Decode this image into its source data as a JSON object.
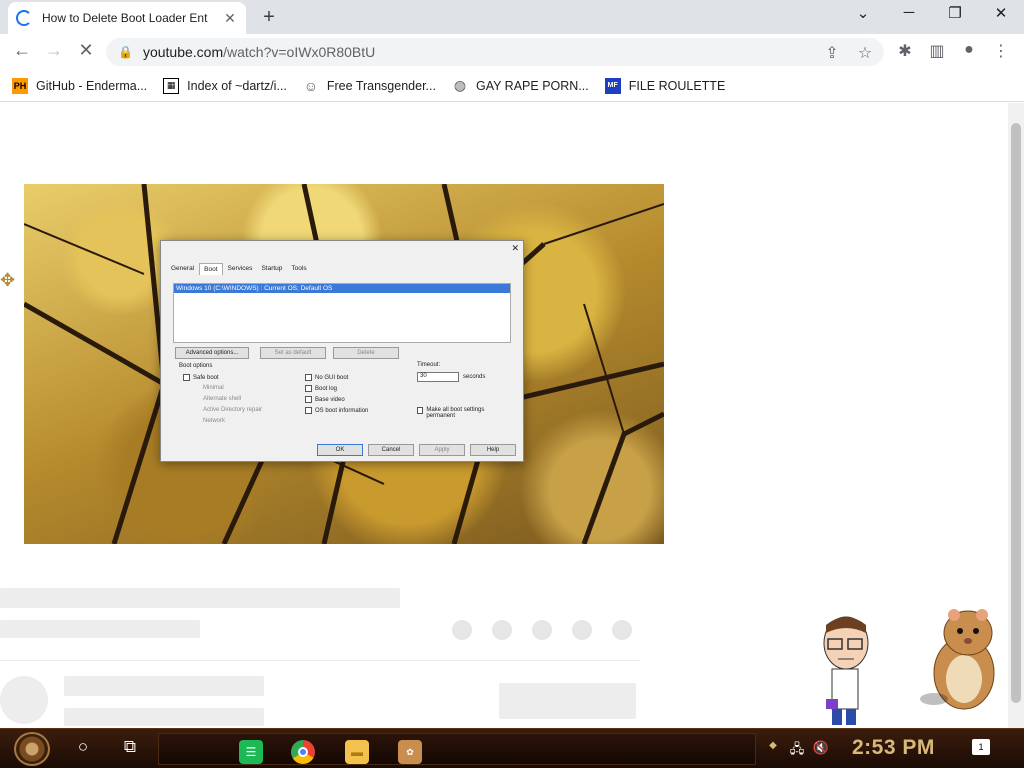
{
  "browser": {
    "tab": {
      "title": "How to Delete Boot Loader Ent",
      "close": "✕"
    },
    "new_tab": "+",
    "window_controls": {
      "chevron": "⌄",
      "minimize": "─",
      "restore": "❐",
      "close": "✕"
    },
    "address": {
      "host": "youtube.com",
      "path": "/watch?v=oIWx0R80BtU"
    },
    "bookmarks": [
      {
        "label": "GitHub - Enderma...",
        "icon_text": "PH",
        "icon": "pornhub-style-icon",
        "color": "#f90"
      },
      {
        "label": "Index of ~dartz/i...",
        "icon_text": "▦",
        "icon": "qr-icon",
        "color": "#000"
      },
      {
        "label": "Free Transgender...",
        "icon_text": "☺",
        "icon": "avatar-icon",
        "color": "#555"
      },
      {
        "label": "GAY RAPE PORN...",
        "icon_text": "◍",
        "icon": "globe-icon",
        "color": "#555"
      },
      {
        "label": "FILE ROULETTE",
        "icon_text": "MF",
        "icon": "mediafire-icon",
        "color": "#1e3fbf"
      }
    ]
  },
  "dialog": {
    "close": "✕",
    "tabs": [
      "General",
      "Boot",
      "Services",
      "Startup",
      "Tools"
    ],
    "active_tab": "Boot",
    "list_item": "Windows 10 (C:\\WINDOWS) : Current OS; Default OS",
    "buttons": {
      "advanced": "Advanced options...",
      "set_default": "Set as default",
      "delete": "Delete",
      "ok": "OK",
      "cancel": "Cancel",
      "apply": "Apply",
      "help": "Help"
    },
    "boot_options_label": "Boot options",
    "safe_boot": "Safe boot",
    "safe_sub": [
      "Minimal",
      "Alternate shell",
      "Active Directory repair",
      "Network"
    ],
    "right_opts": [
      "No GUI boot",
      "Boot log",
      "Base video",
      "OS boot information"
    ],
    "timeout_label": "Timeout:",
    "timeout_value": "30",
    "seconds": "seconds",
    "permanent": "Make all boot settings permanent"
  },
  "taskbar": {
    "clock": "2:53 PM",
    "notifications": "1"
  }
}
